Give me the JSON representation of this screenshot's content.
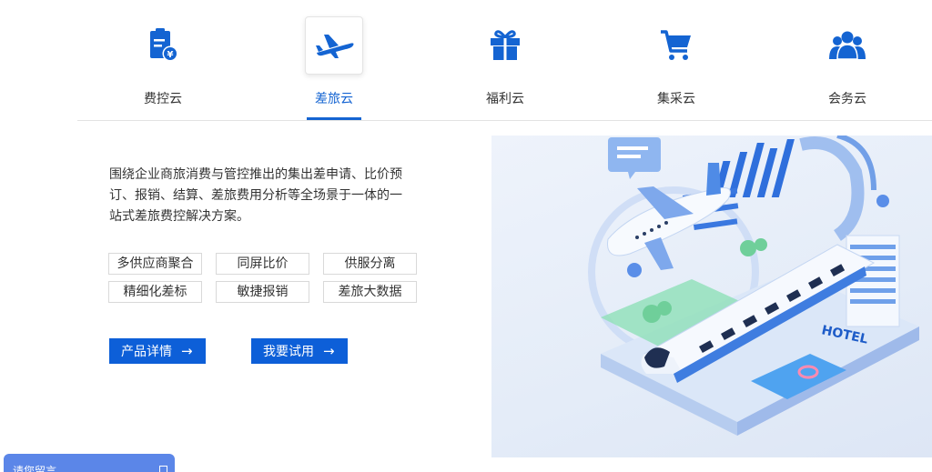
{
  "tabs": [
    {
      "label": "费控云",
      "icon": "receipt-yen-icon"
    },
    {
      "label": "差旅云",
      "icon": "airplane-icon"
    },
    {
      "label": "福利云",
      "icon": "gift-icon"
    },
    {
      "label": "集采云",
      "icon": "shopping-cart-icon"
    },
    {
      "label": "会务云",
      "icon": "group-icon"
    }
  ],
  "active_tab": 1,
  "content": {
    "description": "围绕企业商旅消费与管控推出的集出差申请、比价预订、报销、结算、差旅费用分析等全场景于一体的一站式差旅费控解决方案。",
    "tags": [
      "多供应商聚合",
      "同屏比价",
      "供服分离",
      "精细化差标",
      "敏捷报销",
      "差旅大数据"
    ],
    "buttons": {
      "details": "产品详情",
      "trial": "我要试用",
      "arrow": "→"
    },
    "hero_sign": "HOTEL"
  },
  "chat": {
    "label": "请您留言"
  },
  "colors": {
    "accent": "#1464d2",
    "button": "#0d5fd8",
    "chat": "#5b86e8"
  }
}
